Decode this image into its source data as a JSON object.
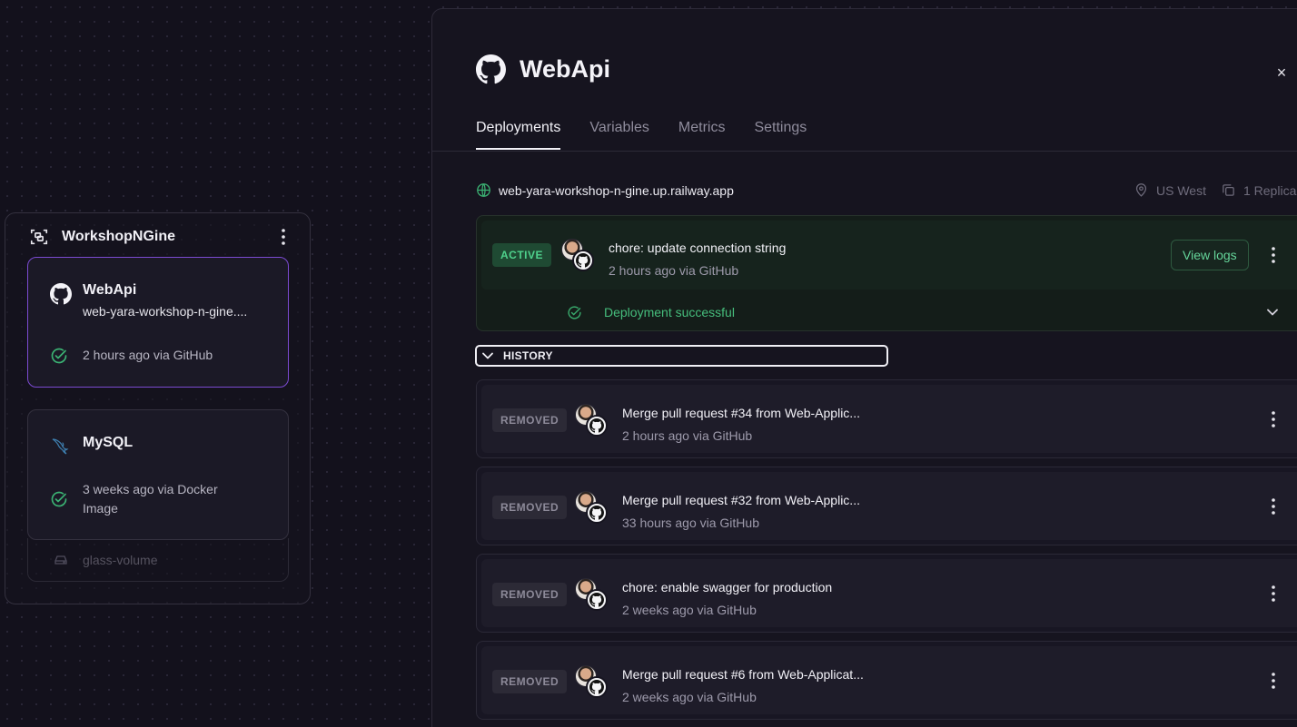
{
  "canvas": {
    "project_name": "WorkshopNGine",
    "services": [
      {
        "name": "WebApi",
        "url": "web-yara-workshop-n-gine....",
        "status": "2 hours ago via GitHub",
        "icon": "github-icon"
      },
      {
        "name": "MySQL",
        "status": "3 weeks ago via Docker Image",
        "icon": "mysql-dolphin-icon"
      }
    ],
    "volume": "glass-volume"
  },
  "panel": {
    "title": "WebApi",
    "close_glyph": "×",
    "tabs": [
      {
        "label": "Deployments",
        "active": true
      },
      {
        "label": "Variables",
        "active": false
      },
      {
        "label": "Metrics",
        "active": false
      },
      {
        "label": "Settings",
        "active": false
      }
    ],
    "domain": "web-yara-workshop-n-gine.up.railway.app",
    "region": "US West",
    "replicas": "1 Replica",
    "active_deployment": {
      "badge": "ACTIVE",
      "message": "chore: update connection string",
      "meta": "2 hours ago via GitHub",
      "view_logs": "View logs",
      "status": "Deployment successful"
    },
    "history_label": "HISTORY",
    "history": [
      {
        "badge": "REMOVED",
        "message": "Merge pull request #34 from Web-Applic...",
        "meta": "2 hours ago via GitHub"
      },
      {
        "badge": "REMOVED",
        "message": "Merge pull request #32 from Web-Applic...",
        "meta": "33 hours ago via GitHub"
      },
      {
        "badge": "REMOVED",
        "message": "chore: enable swagger for production",
        "meta": "2 weeks ago via GitHub"
      },
      {
        "badge": "REMOVED",
        "message": "Merge pull request #6 from Web-Applicat...",
        "meta": "2 weeks ago via GitHub"
      }
    ]
  },
  "colors": {
    "background": "#13111c",
    "accent_purple": "#7b4ad1",
    "success_green": "#46bd7c",
    "active_badge_bg": "#1f4a33"
  }
}
